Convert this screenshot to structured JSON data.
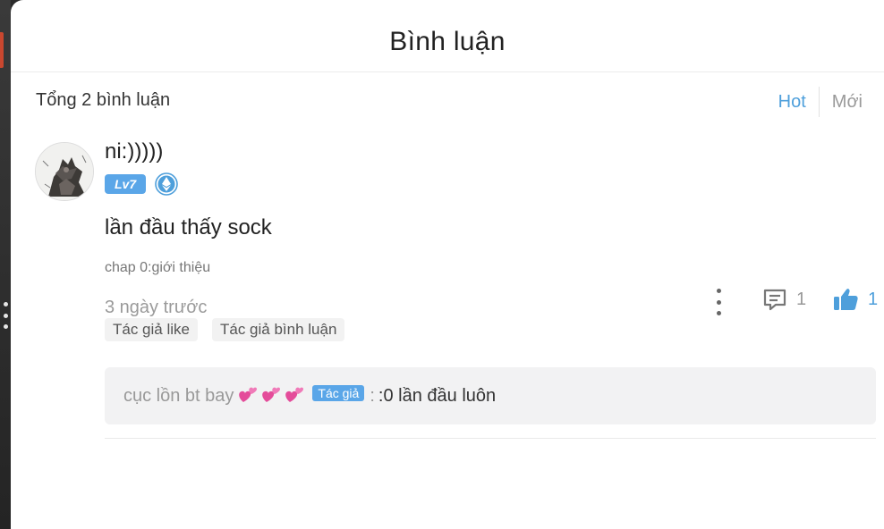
{
  "panel": {
    "title": "Bình luận"
  },
  "subbar": {
    "total_label": "Tổng 2 bình luận",
    "sort_tabs": [
      {
        "label": "Hot",
        "active": true
      },
      {
        "label": "Mới",
        "active": false
      }
    ]
  },
  "comment": {
    "username": "ni:)))))",
    "level": "Lv7",
    "rank_icon": "ethereum-gem-icon",
    "body": "lần đầu thấy sock",
    "chapter": "chap 0:giới thiệu",
    "time": "3 ngày trước",
    "reply_count": "1",
    "like_count": "1",
    "tags": [
      "Tác giả like",
      "Tác giả bình luận"
    ],
    "reply": {
      "author": "cục lồn bt bay",
      "author_tag": "Tác giả",
      "separator": ":",
      "text": ":0 lần đầu luôn"
    }
  },
  "colors": {
    "accent": "#4e9fdb",
    "badge": "#5aa6e8",
    "reply_bg": "#f2f2f3"
  }
}
